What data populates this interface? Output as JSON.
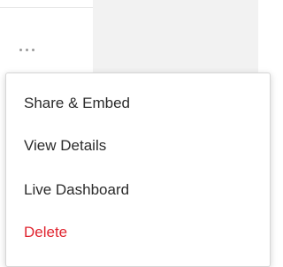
{
  "toolbar": {
    "more_icon": "more-horizontal-icon"
  },
  "menu": {
    "items": [
      {
        "label": "Share & Embed"
      },
      {
        "label": "View Details"
      },
      {
        "label": "Live Dashboard"
      },
      {
        "label": "Delete"
      }
    ]
  },
  "colors": {
    "danger": "#e0242f",
    "text": "#2b2b2b",
    "panel_bg": "#f2f2f2"
  }
}
